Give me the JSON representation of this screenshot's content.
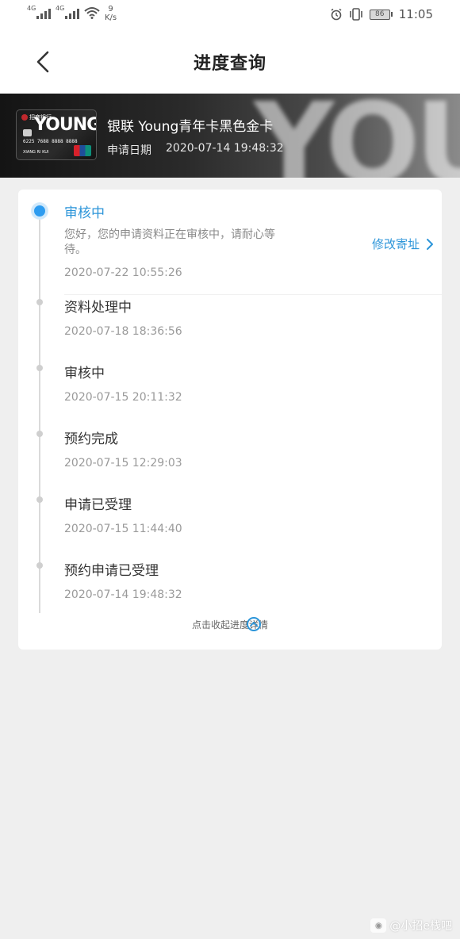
{
  "status_bar": {
    "signal1_label": "4G",
    "signal2_label": "4G",
    "net_speed_value": "9",
    "net_speed_unit": "K/s",
    "battery": "86",
    "time": "11:05"
  },
  "header": {
    "title": "进度查询"
  },
  "card": {
    "name": "银联 Young青年卡黑色金卡",
    "apply_date_label": "申请日期",
    "apply_date": "2020-07-14 19:48:32",
    "thumb_text": "YOUNG",
    "thumb_bank": "招商银行",
    "thumb_number": "6225 7688 8888 8888",
    "thumb_holder": "XIANG RI KUI"
  },
  "timeline": {
    "current": {
      "title": "审核中",
      "desc": "您好，您的申请资料正在审核中，请耐心等待。",
      "time": "2020-07-22 10:55:26",
      "action_label": "修改寄址"
    },
    "steps": [
      {
        "title": "资料处理中",
        "time": "2020-07-18 18:36:56"
      },
      {
        "title": "审核中",
        "time": "2020-07-15 20:11:32"
      },
      {
        "title": "预约完成",
        "time": "2020-07-15 12:29:03"
      },
      {
        "title": "申请已受理",
        "time": "2020-07-15 11:44:40"
      },
      {
        "title": "预约申请已受理",
        "time": "2020-07-14 19:48:32"
      }
    ]
  },
  "collapse": {
    "label": "点击收起进度详情"
  },
  "watermark": {
    "text": "@小招e栈吧"
  },
  "colors": {
    "accent": "#2c95d9",
    "current_dot": "#2d9cf0"
  }
}
